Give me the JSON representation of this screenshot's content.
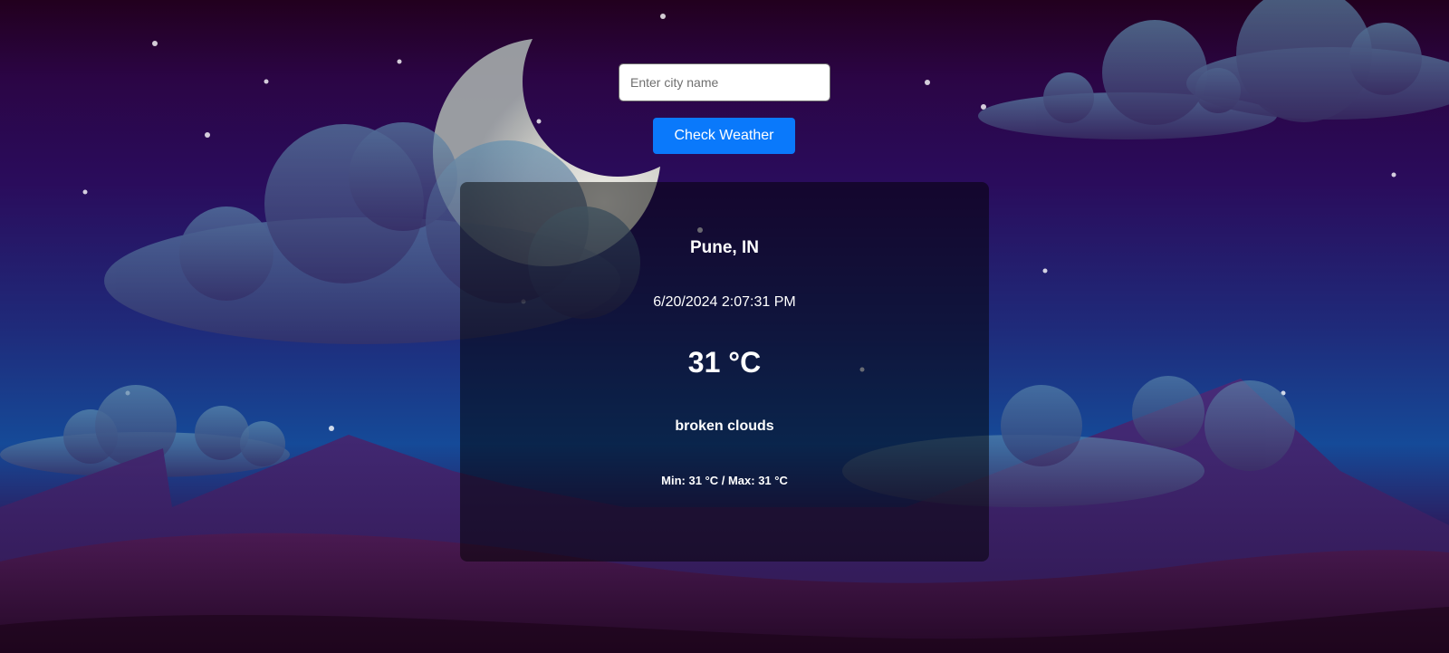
{
  "search": {
    "placeholder": "Enter city name",
    "value": ""
  },
  "button": {
    "label": "Check Weather"
  },
  "weather": {
    "city": "Pune, IN",
    "datetime": "6/20/2024 2:07:31 PM",
    "temperature": "31 °C",
    "description": "broken clouds",
    "min_max": "Min: 31 °C / Max: 31 °C"
  },
  "colors": {
    "button": "#0a79fb",
    "card_overlay": "rgba(0,0,0,0.5)",
    "text": "#ffffff"
  }
}
